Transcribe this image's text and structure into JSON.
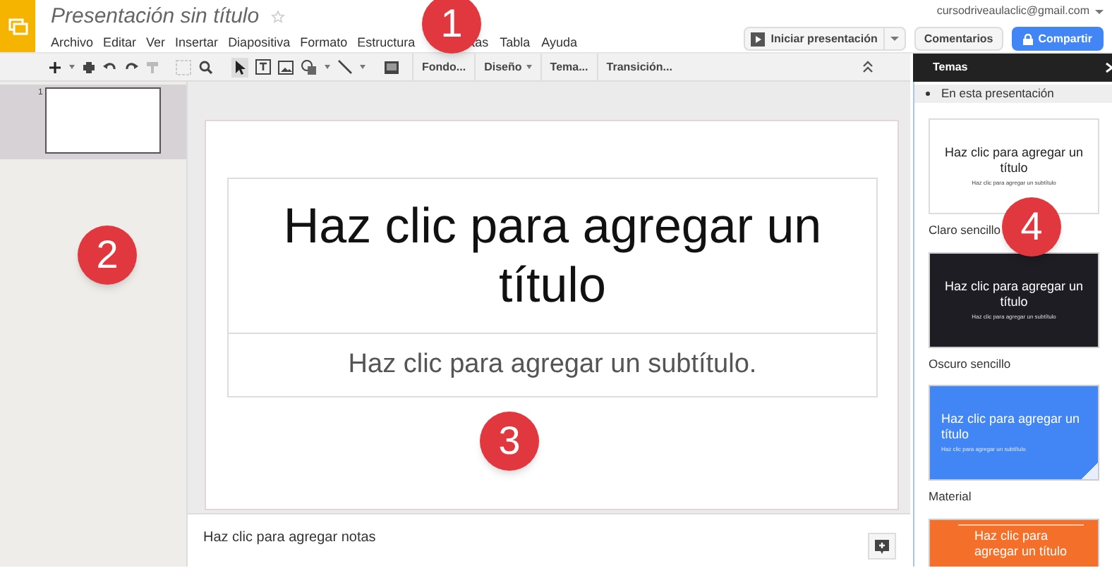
{
  "document_title": "Presentación sin título",
  "menu": [
    "Archivo",
    "Editar",
    "Ver",
    "Insertar",
    "Diapositiva",
    "Formato",
    "Estructura",
    "tas",
    "Tabla",
    "Ayuda"
  ],
  "account": "cursodriveaulaclic@gmail.com",
  "buttons": {
    "present": "Iniciar presentación",
    "comments": "Comentarios",
    "share": "Compartir"
  },
  "toolbar_menus": [
    {
      "label": "Fondo...",
      "dropdown": false
    },
    {
      "label": "Diseño",
      "dropdown": true
    },
    {
      "label": "Tema...",
      "dropdown": false
    },
    {
      "label": "Transición...",
      "dropdown": false
    }
  ],
  "slides": [
    {
      "number": "1",
      "selected": true
    }
  ],
  "slide": {
    "title": "Haz clic para agregar un título",
    "subtitle": "Haz clic para agregar un subtítulo."
  },
  "notes": {
    "placeholder": "Haz clic para agregar notas"
  },
  "themes_panel": {
    "title": "Temas",
    "section": "En esta presentación",
    "themes": [
      {
        "kind": "light",
        "name": "Claro sencillo",
        "title": "Haz clic para agregar un título",
        "subtitle": "Haz clic para agregar un subtítulo"
      },
      {
        "kind": "dark",
        "name": "Oscuro sencillo",
        "title": "Haz clic para agregar un título",
        "subtitle": "Haz clic para agregar un subtítulo"
      },
      {
        "kind": "material",
        "name": "Material",
        "title": "Haz clic para agregar un título",
        "subtitle": "Haz clic para agregar un subtítulo"
      },
      {
        "kind": "orange",
        "title": "Haz clic para agregar un título"
      }
    ]
  },
  "callouts": [
    "1",
    "2",
    "3",
    "4"
  ]
}
